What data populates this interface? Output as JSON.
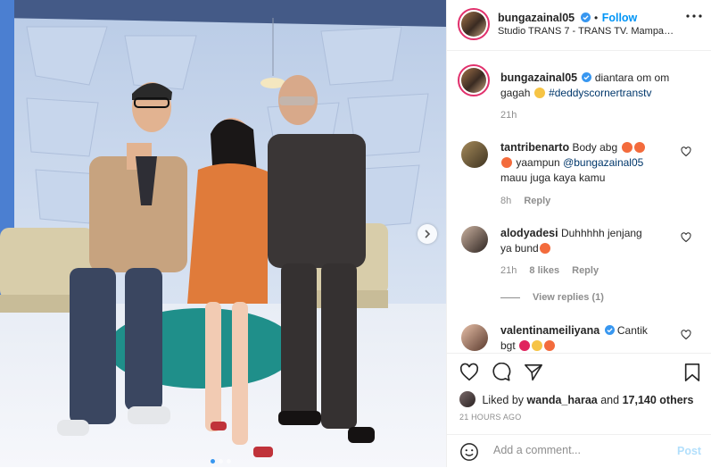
{
  "post": {
    "author": "bungazainal05",
    "follow_label": "Follow",
    "location": "Studio TRANS 7 - TRANS TV. Mampang pr...",
    "caption_text": "diantara om om gagah",
    "caption_hashtag": "#deddyscornertranstv",
    "caption_time": "21h"
  },
  "comments": [
    {
      "user": "tantribenarto",
      "text_1": "Body abg",
      "text_2": "yaampun",
      "mention": "@bungazainal05",
      "text_3": "mauu juga kaya kamu",
      "time": "8h",
      "reply_label": "Reply"
    },
    {
      "user": "alodyadesi",
      "text_1": "Duhhhhh jenjang",
      "text_2": "ya bund",
      "time": "21h",
      "likes": "8 likes",
      "reply_label": "Reply",
      "view_replies": "View replies (1)"
    },
    {
      "user": "valentinameiliyana",
      "text_1": "Cantik",
      "text_2": "bgt"
    }
  ],
  "likes": {
    "prefix": "Liked by",
    "liker": "wanda_haraa",
    "and": "and",
    "count": "17,140 others"
  },
  "time_ago": "21 HOURS AGO",
  "add_comment": {
    "placeholder": "Add a comment...",
    "post_label": "Post"
  },
  "icons": [
    "verified-icon",
    "more-icon",
    "heart-icon",
    "comment-icon",
    "share-icon",
    "bookmark-icon",
    "emoji-icon",
    "next-arrow-icon"
  ],
  "colors": {
    "link": "#0095f6",
    "text": "#262626",
    "muted": "#8e8e8e",
    "post_disabled": "#b2dffc"
  }
}
